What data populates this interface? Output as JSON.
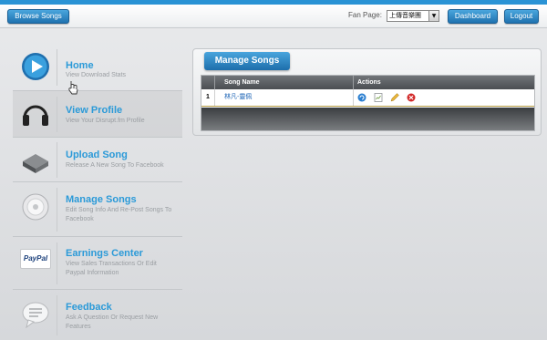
{
  "header": {
    "browse_label": "Browse Songs",
    "fan_page_label": "Fan Page:",
    "fan_page_value": "上傳音樂團",
    "dashboard_label": "Dashboard",
    "logout_label": "Logout"
  },
  "sidebar": {
    "items": [
      {
        "title": "Home",
        "desc": "View Download Stats",
        "icon": "play-icon"
      },
      {
        "title": "View Profile",
        "desc": "View Your Disrupt.fm Profile",
        "icon": "headphones-icon"
      },
      {
        "title": "Upload Song",
        "desc": "Release A New Song To Facebook",
        "icon": "upload-drive-icon"
      },
      {
        "title": "Manage Songs",
        "desc": "Edit Song Info And Re-Post Songs To Facebook",
        "icon": "disc-icon"
      },
      {
        "title": "Earnings Center",
        "desc": "View Sales Transactions Or Edit Paypal Information",
        "icon": "paypal-icon",
        "icon_text": "PayPal"
      },
      {
        "title": "Feedback",
        "desc": "Ask A Question Or Request New Features",
        "icon": "chat-bubble-icon"
      }
    ]
  },
  "main": {
    "panel_title": "Manage Songs",
    "table": {
      "columns": [
        "Song Name",
        "Actions"
      ],
      "rows": [
        {
          "num": "1",
          "song": "林凡-靈佩",
          "actions": [
            "refresh-icon",
            "chart-icon",
            "edit-pencil-icon",
            "delete-icon"
          ]
        }
      ]
    }
  },
  "colors": {
    "accent": "#2b9ad8",
    "button_top": "#4aa6dd",
    "button_bottom": "#1f72b0",
    "top_stripe": "#2a93d5"
  }
}
